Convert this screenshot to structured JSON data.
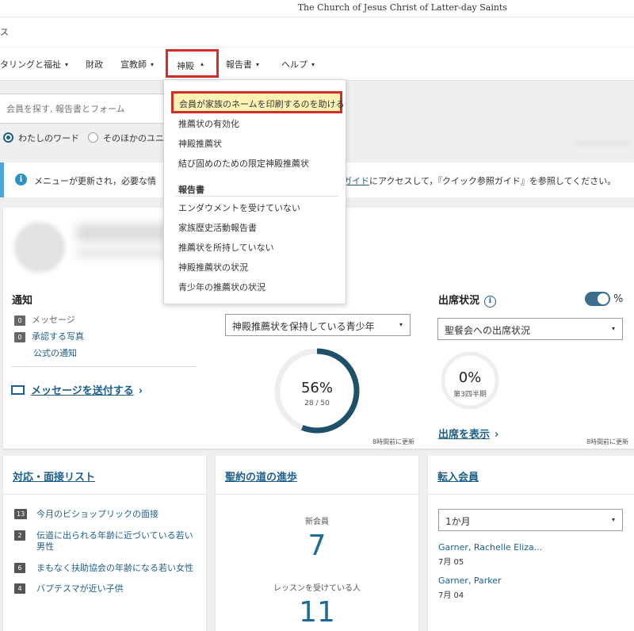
{
  "header": {
    "church_name": "The Church of Jesus Christ of Latter-day Saints",
    "app_title": "ス"
  },
  "nav": {
    "items": [
      {
        "label": "タリングと福祉",
        "caret": "▾"
      },
      {
        "label": "財政",
        "caret": ""
      },
      {
        "label": "宣教師",
        "caret": "▾"
      },
      {
        "label": "神殿",
        "caret": "▴"
      },
      {
        "label": "報告書",
        "caret": "▾"
      },
      {
        "label": "ヘルプ",
        "caret": "▾"
      }
    ]
  },
  "search": {
    "placeholder": "会員を探す, 報告書とフォーム",
    "radio_mine": "わたしのワード",
    "radio_other": "そのほかのユニ"
  },
  "info": {
    "text_start": "メニューが更新され，必要な情",
    "link": "ガイド",
    "text_end": "にアクセスして，『クイック参照ガイド』を参照してください。"
  },
  "temple_menu": {
    "highlighted": "会員が家族のネームを印刷するのを助ける",
    "items": [
      "推薦状の有効化",
      "神殿推薦状",
      "結び固めのための限定神殿推薦状"
    ],
    "reports_heading": "報告書",
    "reports": [
      "エンダウメントを受けていない",
      "家族歴史活動報告書",
      "推薦状を所持していない",
      "神殿推薦状の状況",
      "青少年の推薦状の状況"
    ]
  },
  "notifications": {
    "title": "通知",
    "messages_count": "0",
    "messages_label": "メッセージ",
    "photos_count": "0",
    "photos_label": "承認する写真",
    "official_label": "公式の通知",
    "send_label": "メッセージを送付する"
  },
  "recommend_panel": {
    "select_value": "神殿推薦状を保持している青少年",
    "percent_text": "56%",
    "fraction_text": "28 / 50",
    "updated": "8時間前に更新"
  },
  "attendance": {
    "title": "出席状況",
    "toggle_label": "%",
    "select_value": "聖餐会への出席状況",
    "percent_text": "0%",
    "period": "第3四半期",
    "show_label": "出席を表示",
    "updated": "8時間前に更新"
  },
  "interviews": {
    "title": "対応・面接リスト",
    "rows": [
      {
        "count": "13",
        "label": "今月のビショップリックの面接"
      },
      {
        "count": "2",
        "label": "伝道に出られる年齢に近づいている若い男性"
      },
      {
        "count": "6",
        "label": "まもなく扶助協会の年齢になる若い女性"
      },
      {
        "count": "4",
        "label": "バプテスマが近い子供"
      }
    ]
  },
  "covenant": {
    "title": "聖約の道の進歩",
    "new_members_label": "新会員",
    "new_members_value": "7",
    "lessons_label": "レッスンを受けている人",
    "lessons_value": "11"
  },
  "move_ins": {
    "title": "転入会員",
    "select_value": "1か月",
    "people": [
      {
        "name": "Garner, Rachelle Eliza...",
        "date": "7月 05"
      },
      {
        "name": "Garner, Parker",
        "date": "7月 04"
      }
    ]
  },
  "progress": {
    "recommend_fraction": 0.56,
    "attendance_fraction": 0.0
  },
  "colors": {
    "accent_blue": "#1c5e8c",
    "donut_fill": "#1e4f6b",
    "highlight_red": "#d22f27",
    "highlight_yellow": "#fbf3b4"
  }
}
